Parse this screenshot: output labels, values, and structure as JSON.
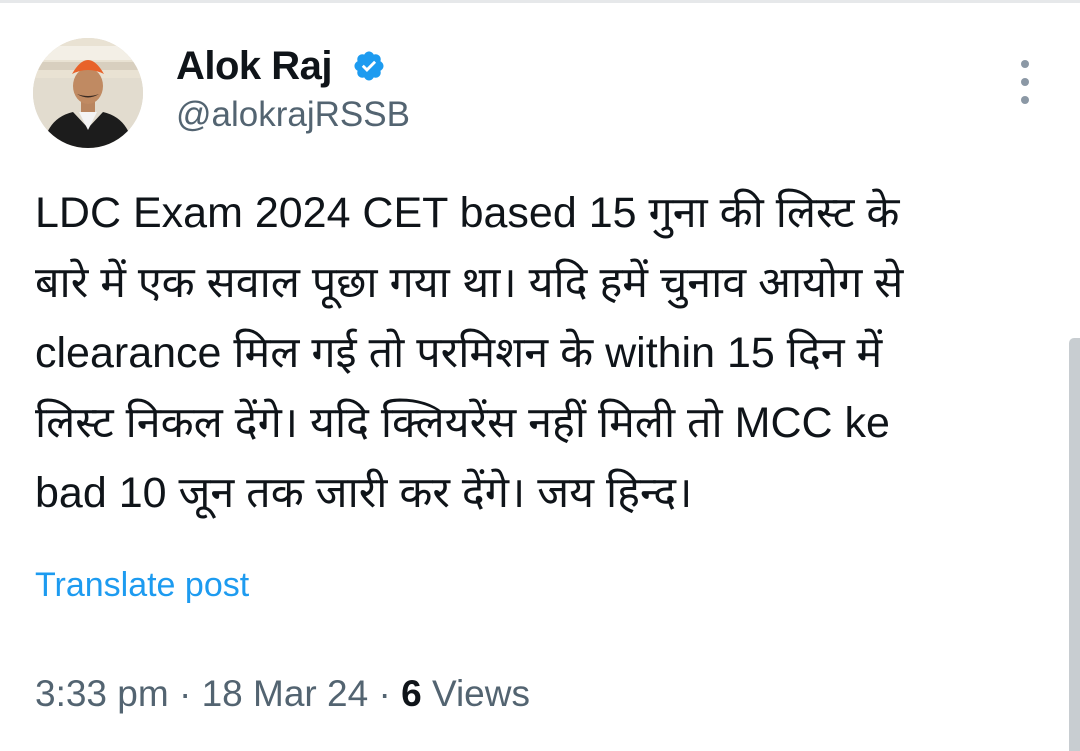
{
  "colors": {
    "text_primary": "#0f1419",
    "text_secondary": "#536471",
    "link": "#1d9bf0",
    "verified_badge": "#1d9bf0"
  },
  "author": {
    "display_name": "Alok Raj",
    "handle": "@alokrajRSSB",
    "verified": true,
    "avatar_icon": "profile-photo"
  },
  "menu": {
    "icon": "more-vertical-icon"
  },
  "tweet": {
    "lines": [
      "LDC Exam 2024 CET based 15 गुना की लिस्ट के",
      "बारे में एक सवाल पूछा गया था। यदि हमें चुनाव आयोग से",
      "clearance मिल गई तो परमिशन के within 15 दिन में",
      "लिस्ट निकल देंगे। यदि क्लियरेंस नहीं मिली तो MCC ke",
      "bad 10 जून तक जारी कर देंगे। जय हिन्द।"
    ],
    "translate_label": "Translate post",
    "time": "3:33 pm",
    "separator": "·",
    "date": "18 Mar 24",
    "views_count": "6",
    "views_label": "Views"
  }
}
